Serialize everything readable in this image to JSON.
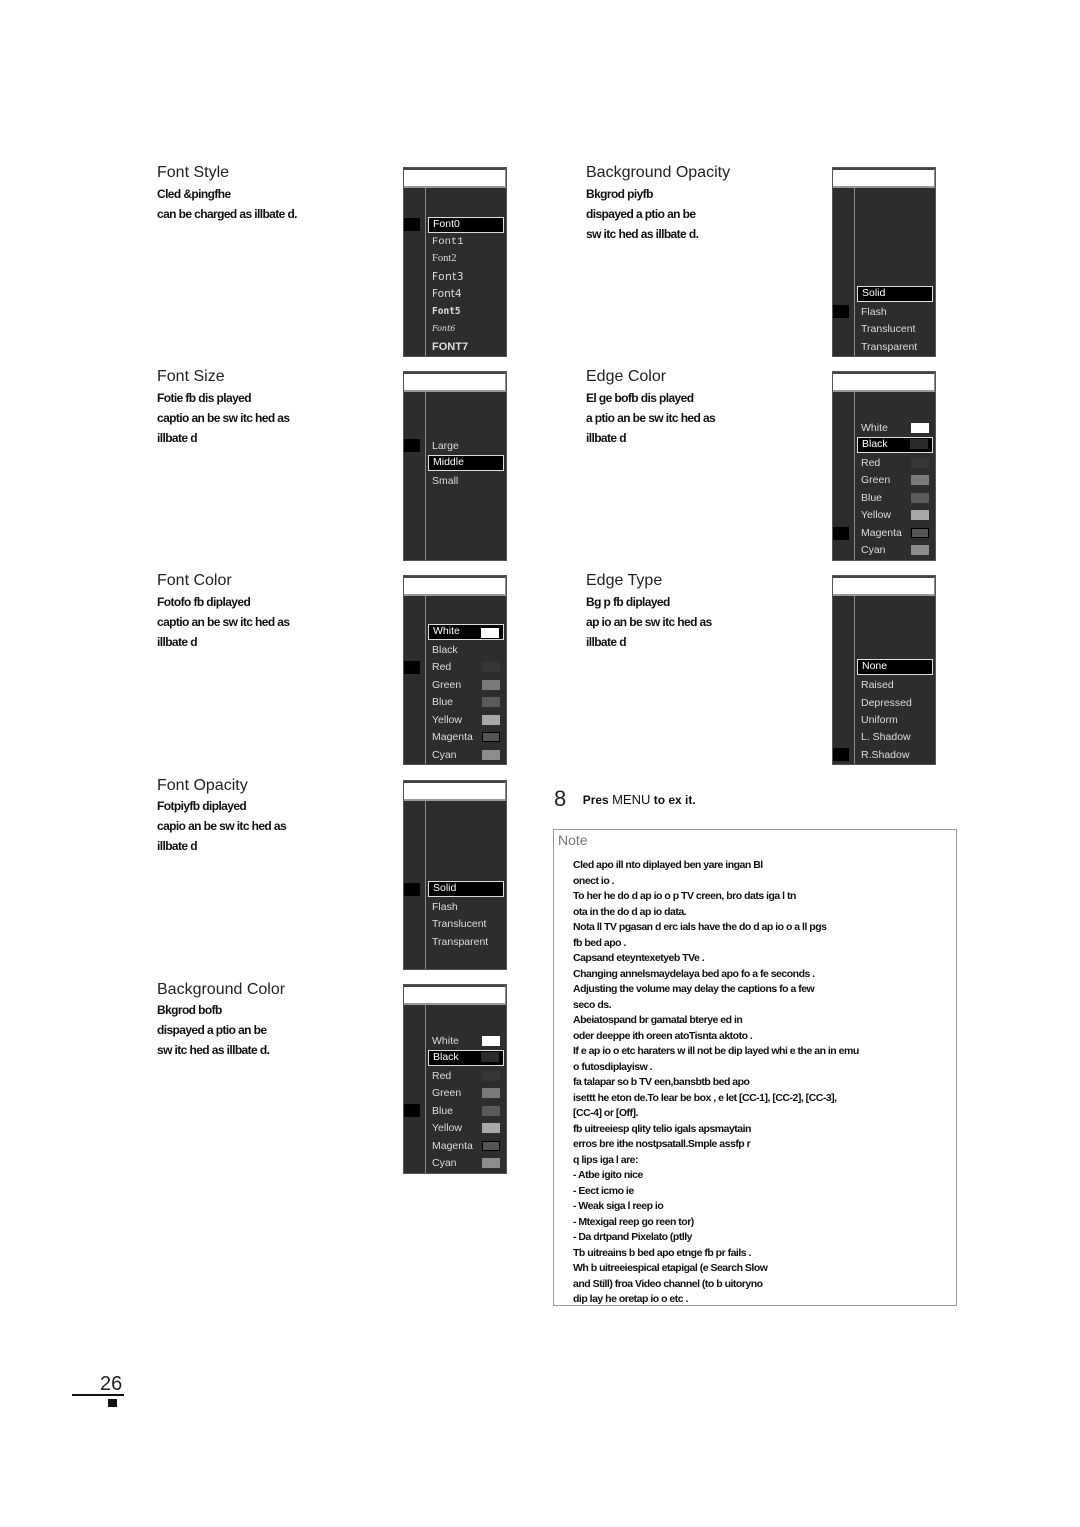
{
  "sections": [
    {
      "id": "font-style",
      "title": "Font Style",
      "desc": [
        "Cled &pingfhe",
        "can be charged as illbate      d."
      ],
      "items": [
        {
          "label": "Font0",
          "selected": true
        },
        {
          "label": "Font1"
        },
        {
          "label": "Font2"
        },
        {
          "label": "Font3"
        },
        {
          "label": "Font4"
        },
        {
          "label": "Font5"
        },
        {
          "label": "Font6"
        },
        {
          "label": "FONT7"
        }
      ]
    },
    {
      "id": "font-size",
      "title": "Font Size",
      "desc": [
        "Fotie fb dis          played",
        "captio an    be sw itc hed as",
        "illbate      d"
      ],
      "items": [
        {
          "label": "Large"
        },
        {
          "label": "Middle",
          "selected": true
        },
        {
          "label": "Small"
        }
      ]
    },
    {
      "id": "font-color",
      "title": "Font Color",
      "desc": [
        "Fotofo fb diplayed",
        "captio an    be sw itc hed as",
        "illbate      d"
      ],
      "items": [
        {
          "label": "White",
          "selected": true,
          "swatch": "#ffffff"
        },
        {
          "label": "Black"
        },
        {
          "label": "Red",
          "swatch": "#353535"
        },
        {
          "label": "Green",
          "swatch": "#7a7a7a"
        },
        {
          "label": "Blue",
          "swatch": "#5a5a5a"
        },
        {
          "label": "Yellow",
          "swatch": "#a8a8a8"
        },
        {
          "label": "Magenta",
          "swatch": "#555555"
        },
        {
          "label": "Cyan",
          "swatch": "#8c8c8c"
        }
      ]
    },
    {
      "id": "font-opacity",
      "title": "Font Opacity",
      "desc": [
        "Fotpiyfb diplayed",
        "capio an    be sw itc hed as",
        "illbate      d"
      ],
      "items": [
        {
          "label": "Solid",
          "selected": true
        },
        {
          "label": "Flash"
        },
        {
          "label": "Translucent"
        },
        {
          "label": "Transparent"
        }
      ]
    },
    {
      "id": "background-color",
      "title": "Background Color",
      "desc": [
        "Bkgrod bofb",
        "dispayed a ptio an    be",
        "sw itc hed as illbate      d."
      ],
      "items": [
        {
          "label": "White",
          "swatch": "#ffffff"
        },
        {
          "label": "Black",
          "selected": true,
          "swatch": "#2a2a2a"
        },
        {
          "label": "Red",
          "swatch": "#353535"
        },
        {
          "label": "Green",
          "swatch": "#7a7a7a"
        },
        {
          "label": "Blue",
          "swatch": "#5a5a5a"
        },
        {
          "label": "Yellow",
          "swatch": "#a8a8a8"
        },
        {
          "label": "Magenta",
          "swatch": "#555555"
        },
        {
          "label": "Cyan",
          "swatch": "#8c8c8c"
        }
      ]
    },
    {
      "id": "background-opacity",
      "title": "Background Opacity",
      "desc": [
        "Bkgrod piyfb",
        "dispayed a ptio an    be",
        "sw itc hed as illbate      d."
      ],
      "items": [
        {
          "label": "Solid",
          "selected": true
        },
        {
          "label": "Flash"
        },
        {
          "label": "Translucent"
        },
        {
          "label": "Transparent"
        }
      ]
    },
    {
      "id": "edge-color",
      "title": "Edge Color",
      "desc": [
        "El ge bofb dis          played",
        "a ptio an    be sw itc hed as",
        "illbate      d"
      ],
      "items": [
        {
          "label": "White",
          "swatch": "#ffffff"
        },
        {
          "label": "Black",
          "selected": true,
          "swatch": "#2a2a2a"
        },
        {
          "label": "Red",
          "swatch": "#353535"
        },
        {
          "label": "Green",
          "swatch": "#7a7a7a"
        },
        {
          "label": "Blue",
          "swatch": "#5a5a5a"
        },
        {
          "label": "Yellow",
          "swatch": "#a8a8a8"
        },
        {
          "label": "Magenta",
          "swatch": "#555555"
        },
        {
          "label": "Cyan",
          "swatch": "#8c8c8c"
        }
      ]
    },
    {
      "id": "edge-type",
      "title": "Edge Type",
      "desc": [
        "Bg p fb diplayed",
        "ap  io an    be sw itc hed as",
        "illbate      d"
      ],
      "items": [
        {
          "label": "None",
          "selected": true
        },
        {
          "label": "Raised"
        },
        {
          "label": "Depressed"
        },
        {
          "label": "Uniform"
        },
        {
          "label": "L. Shadow"
        },
        {
          "label": "R.Shadow"
        }
      ]
    }
  ],
  "step": {
    "number": "8",
    "prefix": "Pres",
    "menu": "MENU",
    "suffix": "to ex  it."
  },
  "note": {
    "title": "Note",
    "lines": [
      "Cled apo ill nto diplayed ben yare ingan Bl",
      "onect   io .",
      "To her    he do    d ap  io o p        TV  creen,  bro dats    iga l tn",
      "ota    in the do    d ap  io   data.",
      "Nota  ll TV  pgasan         d erc           ials have the do    d ap  io o a   ll pgs",
      "fb bed apo                        .",
      "Capsand eteyntexetyeb TVe                                                   .",
      "Changing annelsmaydelaya bed apo fo a fe seconds                             .",
      "Adjusting the volume may delay the captions                       fo a   few",
      "seco    ds.",
      "Abeiatospand br gamatal bterye ed in",
      "oder deeppe ith oreen atoTisnta aktoto                                            .",
      "If  e ap  io o etc        haraters w  ill not  be dip layed whi e the an in emu",
      "o   futosdiplayisw                  .",
      "fa talapar so b TV een,bansbtb bed apo",
      "isettt        he eton       de.To  lear be box , e let  [CC-1], [CC-2], [CC-3],",
      "[CC-4] or [Off].",
      "fb uitreeiesp qlity telio igals apsmaytain",
      "erros bre ithe nostpsatall.Smple assfp                                       r",
      "q    lips   iga l are:",
      "- Atbe igito nice",
      "- Eect  icmo          ie",
      "- Weak siga l reep  io",
      "- Mtexigal reep  go reen                                  tor)",
      "- Da drtpand Pixelato (ptlly",
      "Tb uitreains b bed apo etnge fb pr fails                                 .",
      "Wh b uitreeiespical etapigal (e Search Slow",
      "and Still) froa Video channel (to b uitoryno",
      "dip lay he oretap        io o etc     ."
    ]
  },
  "page": {
    "number": "26",
    "lang": "EN"
  }
}
